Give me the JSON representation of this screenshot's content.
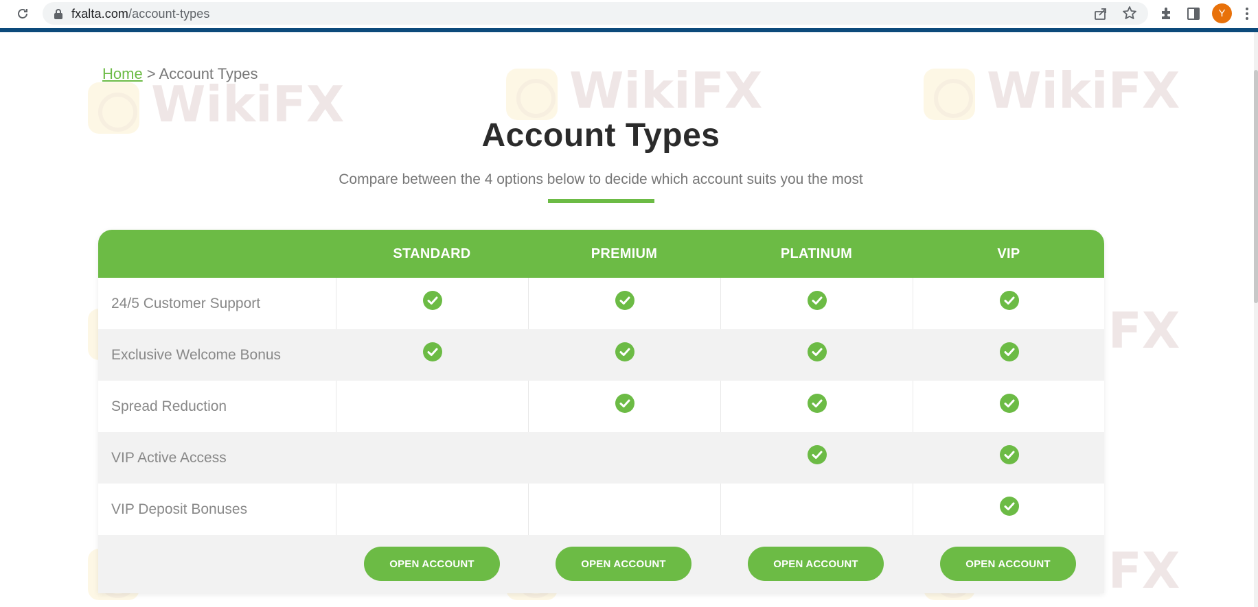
{
  "browser": {
    "url_host": "fxalta.com",
    "url_path": "/account-types",
    "profile_initial": "Y",
    "icons": [
      "reload-icon",
      "lock-icon",
      "share-icon",
      "star-icon",
      "extensions-icon",
      "side-panel-icon",
      "menu-icon"
    ]
  },
  "breadcrumb": {
    "home": "Home",
    "separator": " > ",
    "current": "Account Types"
  },
  "page": {
    "title": "Account Types",
    "subtitle": "Compare between the 4 options below to decide which account suits you the most"
  },
  "table": {
    "plans": [
      "STANDARD",
      "PREMIUM",
      "PLATINUM",
      "VIP"
    ],
    "features": [
      {
        "label": "24/5 Customer Support",
        "included": [
          true,
          true,
          true,
          true
        ]
      },
      {
        "label": "Exclusive Welcome Bonus",
        "included": [
          true,
          true,
          true,
          true
        ]
      },
      {
        "label": "Spread Reduction",
        "included": [
          false,
          true,
          true,
          true
        ]
      },
      {
        "label": "VIP Active Access",
        "included": [
          false,
          false,
          true,
          true
        ]
      },
      {
        "label": "VIP Deposit Bonuses",
        "included": [
          false,
          false,
          false,
          true
        ]
      }
    ],
    "button_label": "OPEN ACCOUNT"
  },
  "watermark": {
    "text": "WikiFX"
  },
  "colors": {
    "accent": "#6cbb45",
    "stripe": "#0c4a7b"
  }
}
